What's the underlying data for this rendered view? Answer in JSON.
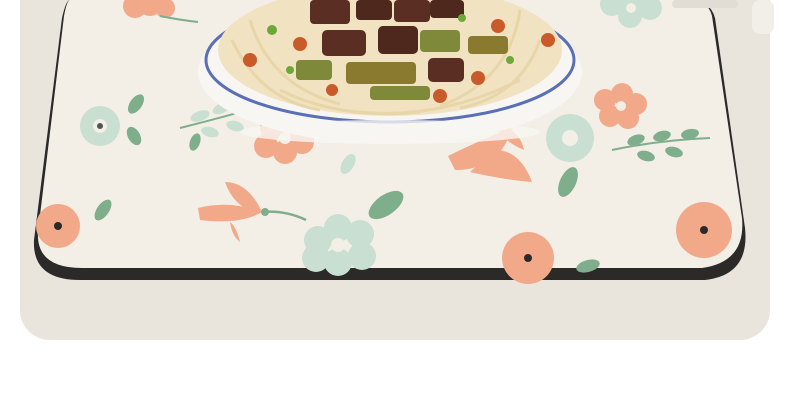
{
  "image": {
    "subject": "product-photo",
    "colors": {
      "page_background": "#ffffff",
      "table_surface": "#e9e4dc",
      "mat_surface": "#f3eee6",
      "mat_edge": "#2b2a28",
      "bowl_white": "#f7f6f2",
      "bowl_rim_blue": "#5a6fb5",
      "noodles": "#f1e3c2",
      "beef": "#5a2e22",
      "green_beans": "#7e8a3a",
      "chili": "#c95a2a",
      "flower_peach": "#f2a98a",
      "flower_mint": "#c9dfd2",
      "leaf_green": "#7fae8c"
    }
  }
}
